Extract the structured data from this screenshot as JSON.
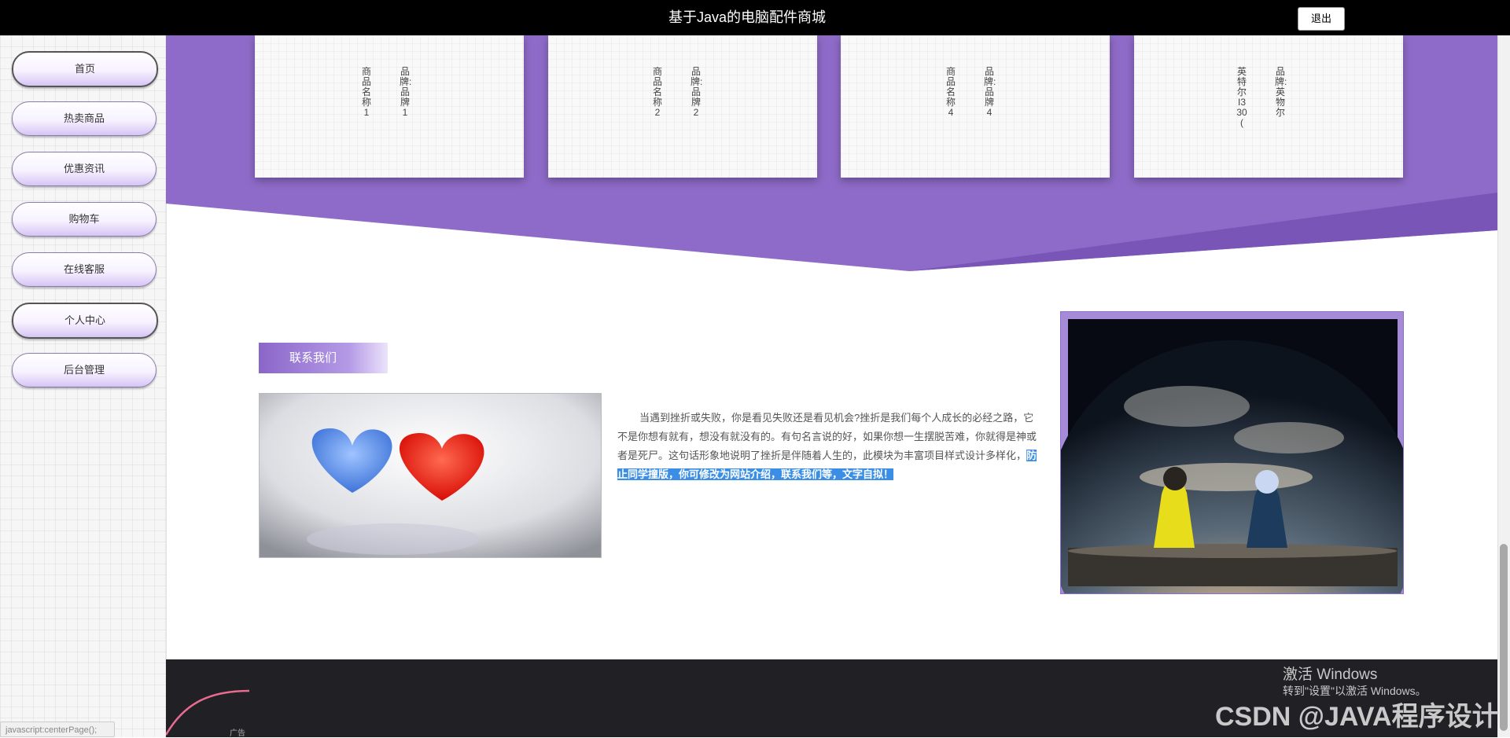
{
  "header": {
    "title": "基于Java的电脑配件商城",
    "logout_label": "退出"
  },
  "sidebar": {
    "items": [
      {
        "label": "首页",
        "active": true
      },
      {
        "label": "热卖商品",
        "active": false
      },
      {
        "label": "优惠资讯",
        "active": false
      },
      {
        "label": "购物车",
        "active": false
      },
      {
        "label": "在线客服",
        "active": false
      },
      {
        "label": "个人中心",
        "active": true
      },
      {
        "label": "后台管理",
        "active": false
      }
    ]
  },
  "products": [
    {
      "name": "商品名称1",
      "brand": "品牌:品牌1"
    },
    {
      "name": "商品名称2",
      "brand": "品牌:品牌2"
    },
    {
      "name": "商品名称4",
      "brand": "品牌:品牌4"
    },
    {
      "name": "英特尔I330(",
      "brand": "品牌:英物尔"
    }
  ],
  "contact": {
    "heading": "联系我们",
    "text": "当遇到挫折或失败，你是看见失败还是看见机会?挫折是我们每个人成长的必经之路，它不是你想有就有，想没有就没有的。有句名言说的好，如果你想一生摆脱苦难，你就得是神或者是死尸。这句话形象地说明了挫折是伴随着人生的，此模块为丰富项目样式设计多样化，",
    "highlight": "防止同学撞版，你可修改为网站介绍，联系我们等，文字自拟！"
  },
  "footer": {
    "ad_label": "广告"
  },
  "status_bar": {
    "text": "javascript:centerPage();"
  },
  "watermarks": {
    "activation_title": "激活 Windows",
    "activation_sub": "转到\"设置\"以激活 Windows。",
    "csdn": "CSDN @JAVA程序设计"
  },
  "colors": {
    "accent_purple": "#8e6bc8",
    "header_bg": "#000000",
    "footer_bg": "#212024",
    "highlight_blue": "#3a8ee6"
  }
}
